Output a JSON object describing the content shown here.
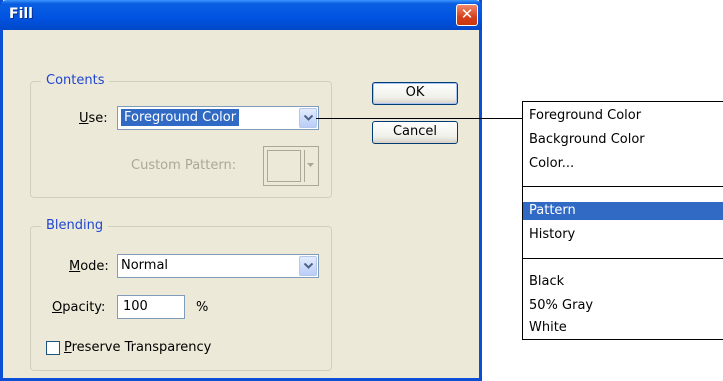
{
  "dialog": {
    "title": "Fill",
    "close_glyph": "✕",
    "contents": {
      "legend": "Contents",
      "use_label_accel": "U",
      "use_label_rest": "se:",
      "use_value": "Foreground Color",
      "custom_pattern_label": "Custom Pattern:"
    },
    "blending": {
      "legend": "Blending",
      "mode_label_accel": "M",
      "mode_label_rest": "ode:",
      "mode_value": "Normal",
      "opacity_label_accel": "O",
      "opacity_label_rest": "pacity:",
      "opacity_value": "100",
      "opacity_unit": "%",
      "preserve_accel": "P",
      "preserve_rest": "reserve Transparency",
      "preserve_checked": false
    },
    "buttons": {
      "ok": "OK",
      "cancel": "Cancel"
    }
  },
  "use_dropdown": {
    "highlighted_index": 3,
    "groups": [
      [
        "Foreground Color",
        "Background Color",
        "Color..."
      ],
      [
        "Pattern",
        "History"
      ],
      [
        "Black",
        "50% Gray",
        "White"
      ]
    ],
    "items": {
      "foreground_color": "Foreground Color",
      "background_color": "Background Color",
      "color": "Color...",
      "pattern": "Pattern",
      "history": "History",
      "black": "Black",
      "gray_50": "50% Gray",
      "white": "White"
    }
  },
  "icons": {
    "close": "close-icon",
    "dropdown_arrow": "chevron-down-icon"
  },
  "colors": {
    "title_bar": "#0054e3",
    "dialog_bg": "#ece9d8",
    "legend_text": "#1f46d1",
    "selection": "#316ac5",
    "close_button": "#d6401c"
  }
}
